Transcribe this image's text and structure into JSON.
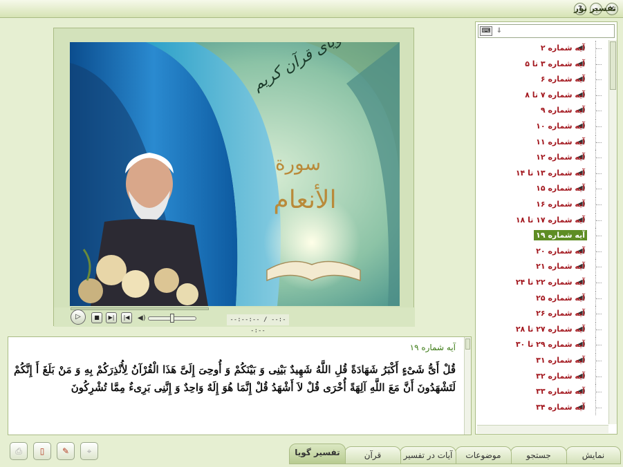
{
  "window": {
    "title": "تفسیر نور",
    "controls": {
      "close": "×",
      "minimize": "–",
      "help": "?"
    }
  },
  "verse_list": {
    "search_placeholder": "",
    "keyboard_icon": "keyboard-icon",
    "items": [
      {
        "label": "آیه شماره ۲",
        "selected": false
      },
      {
        "label": "آیه شماره ۳ تا ۵",
        "selected": false
      },
      {
        "label": "آیه شماره ۶",
        "selected": false
      },
      {
        "label": "آیه شماره ۷ تا ۸",
        "selected": false
      },
      {
        "label": "آیه شماره ۹",
        "selected": false
      },
      {
        "label": "آیه شماره ۱۰",
        "selected": false
      },
      {
        "label": "آیه شماره ۱۱",
        "selected": false
      },
      {
        "label": "آیه شماره ۱۲",
        "selected": false
      },
      {
        "label": "آیه شماره ۱۳ تا ۱۴",
        "selected": false
      },
      {
        "label": "آیه شماره ۱۵",
        "selected": false
      },
      {
        "label": "آیه شماره ۱۶",
        "selected": false
      },
      {
        "label": "آیه شماره ۱۷ تا ۱۸",
        "selected": false
      },
      {
        "label": "آیه شماره ۱۹",
        "selected": true
      },
      {
        "label": "آیه شماره ۲۰",
        "selected": false
      },
      {
        "label": "آیه شماره ۲۱",
        "selected": false
      },
      {
        "label": "آیه شماره ۲۲ تا ۲۴",
        "selected": false
      },
      {
        "label": "آیه شماره ۲۵",
        "selected": false
      },
      {
        "label": "آیه شماره ۲۶",
        "selected": false
      },
      {
        "label": "آیه شماره ۲۷ تا ۲۸",
        "selected": false
      },
      {
        "label": "آیه شماره ۲۹ تا ۳۰",
        "selected": false
      },
      {
        "label": "آیه شماره ۳۱",
        "selected": false
      },
      {
        "label": "آیه شماره ۳۲",
        "selected": false
      },
      {
        "label": "آیه شماره ۳۳",
        "selected": false
      },
      {
        "label": "آیه شماره ۳۴",
        "selected": false
      }
    ]
  },
  "media": {
    "poster_title": "تفسیر گویای قرآن کریم",
    "surah_word": "سورة",
    "surah_name": "الأنعام",
    "time_display": "--:--:-- / --:--:--",
    "volume": 0.45
  },
  "verse_panel": {
    "title": "آیه شماره ۱۹",
    "text": "قُلْ أَیُّ شَیْءٍ أَکْبَرُ شَهَادَةً قُلِ اللَّهُ شَهِیدٌ بَیْنِی وَ بَیْنَکُمْ وَ أُوحِیَ إِلَیَّ هَذَا الْقُرْآنُ لِأُنْذِرَکُمْ بِهِ وَ مَنْ بَلَغَ أَ إِنَّکُمْ لَتَشْهَدُونَ أَنَّ مَعَ اللَّهِ آلِهَةً أُخْرَی قُلْ لاَ أَشْهَدُ قُلْ إِنَّمَا هُوَ إِلَهٌ وَاحِدٌ وَ إِنَّنِی بَرِیءٌ مِمَّا تُشْرِکُونَ"
  },
  "tabs": [
    {
      "label": "نمایش",
      "active": false
    },
    {
      "label": "جستجو",
      "active": false
    },
    {
      "label": "موضوعات",
      "active": false
    },
    {
      "label": "آیات در تفسیر",
      "active": false
    },
    {
      "label": "قرآن",
      "active": false
    },
    {
      "label": "تفسیر گویا",
      "active": true
    }
  ],
  "toolbar": {
    "buttons": [
      {
        "icon": "print-icon",
        "enabled": false
      },
      {
        "icon": "book-icon",
        "enabled": true
      },
      {
        "icon": "edit-note-icon",
        "enabled": true
      },
      {
        "icon": "pin-icon",
        "enabled": false
      }
    ]
  }
}
